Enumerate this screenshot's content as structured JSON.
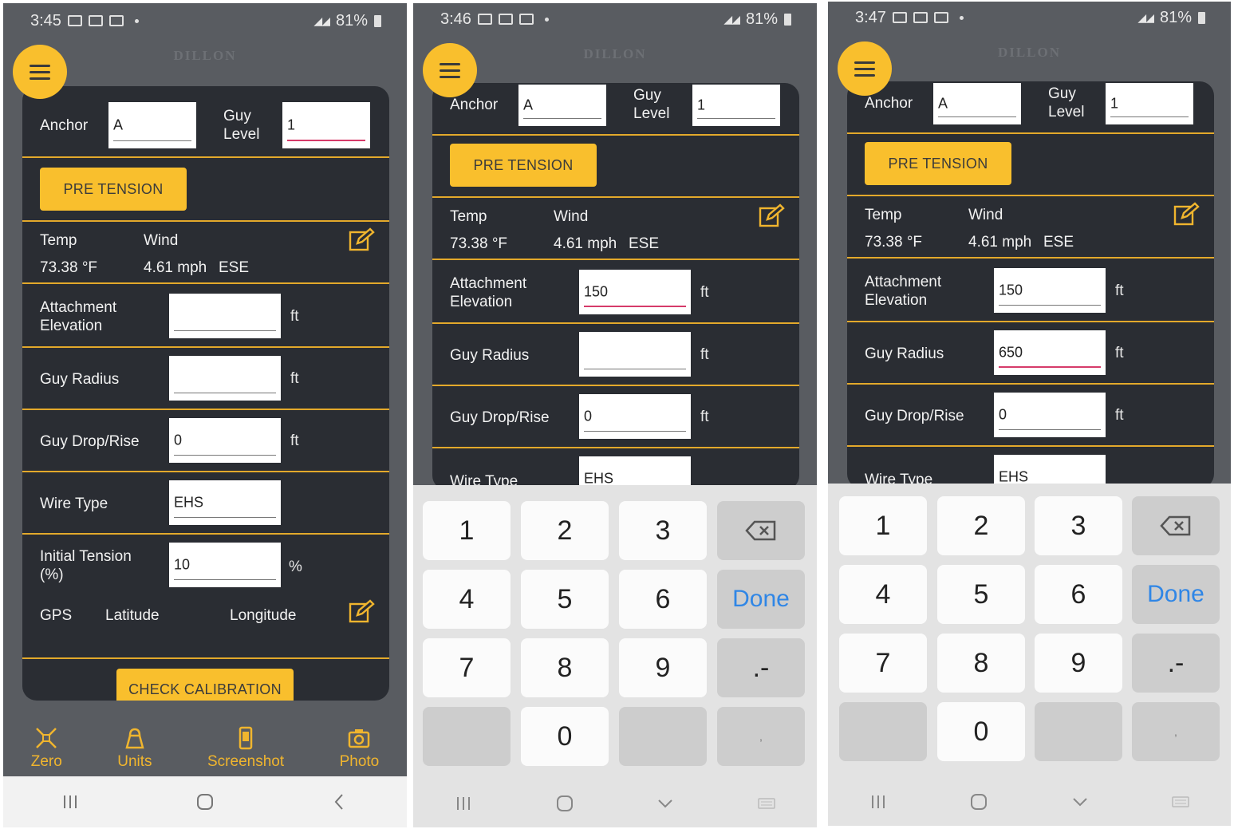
{
  "colors": {
    "accent": "#f9bf2d",
    "panel": "#2a2d33",
    "divider": "#e3a92b",
    "done_key": "#2f86e6",
    "active_underline": "#d63b6a"
  },
  "brand": "DILLON",
  "labels": {
    "anchor": "Anchor",
    "guy": "Guy",
    "level": "Level",
    "pre_tension": "PRE TENSION",
    "temp": "Temp",
    "wind": "Wind",
    "attachment": "Attachment",
    "elevation": "Elevation",
    "guy_radius": "Guy Radius",
    "guy_drop": "Guy Drop/Rise",
    "wire_type": "Wire Type",
    "initial_tension": "Initial Tension",
    "pct_paren": "(%)",
    "gps": "GPS",
    "latitude": "Latitude",
    "longitude": "Longitude",
    "check_calibration": "CHECK CALIBRATION",
    "unit_ft": "ft",
    "unit_pct": "%"
  },
  "weather": {
    "temp": "73.38 °F",
    "wind_speed": "4.61 mph",
    "wind_dir": "ESE"
  },
  "bottom_nav": [
    {
      "label": "Zero",
      "icon": "zero-icon"
    },
    {
      "label": "Units",
      "icon": "units-icon"
    },
    {
      "label": "Screenshot",
      "icon": "screenshot-icon"
    },
    {
      "label": "Photo",
      "icon": "camera-icon"
    }
  ],
  "keypad": {
    "k1": "1",
    "k2": "2",
    "k3": "3",
    "k4": "4",
    "k5": "5",
    "k6": "6",
    "k7": "7",
    "k8": "8",
    "k9": "9",
    "k0": "0",
    "done": "Done",
    "minus": ".-",
    "comma": ","
  },
  "screens": [
    {
      "time": "3:45",
      "battery": "81%",
      "fields": {
        "anchor": "A",
        "guy_level": "1",
        "attachment_elevation": "",
        "guy_radius": "",
        "guy_drop": "0",
        "wire_type": "EHS",
        "initial_tension": "10"
      }
    },
    {
      "time": "3:46",
      "battery": "81%",
      "fields": {
        "anchor": "A",
        "guy_level": "1",
        "attachment_elevation": "150",
        "guy_radius": "",
        "guy_drop": "0",
        "wire_type": "EHS"
      }
    },
    {
      "time": "3:47",
      "battery": "81%",
      "fields": {
        "anchor": "A",
        "guy_level": "1",
        "attachment_elevation": "150",
        "guy_radius": "650",
        "guy_drop": "0",
        "wire_type": "EHS"
      }
    }
  ]
}
